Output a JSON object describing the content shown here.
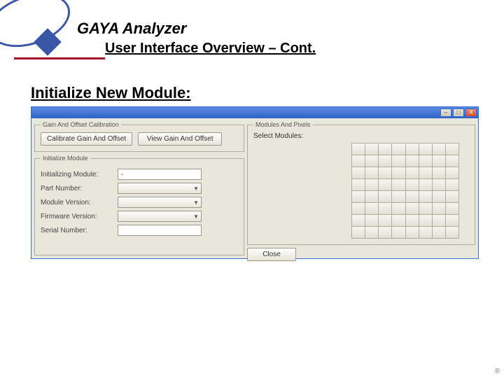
{
  "header": {
    "product": "GAYA Analyzer",
    "subtitle": "User Interface Overview – Cont."
  },
  "section": {
    "title": "Initialize New Module:"
  },
  "window": {
    "title": "",
    "titlebar": {
      "minimize": "–",
      "maximize": "□",
      "close": "X"
    },
    "gainOffset": {
      "legend": "Gain And Offset Calibration",
      "calibrateBtn": "Calibrate Gain And Offset",
      "viewBtn": "View Gain And Offset"
    },
    "initialize": {
      "legend": "Initialize Module",
      "fields": {
        "initializing": {
          "label": "Initializing Module:",
          "value": "-"
        },
        "partNumber": {
          "label": "Part Number:",
          "value": ""
        },
        "moduleVersion": {
          "label": "Module Version:",
          "value": ""
        },
        "firmwareVersion": {
          "label": "Firmware Version:",
          "value": ""
        },
        "serialNumber": {
          "label": "Serial Number:",
          "value": ""
        }
      }
    },
    "modules": {
      "legend": "Modules And Pixels",
      "selectLabel": "Select Modules:",
      "gridRows": 8,
      "gridCols": 8
    },
    "closeBtn": "Close"
  },
  "footer": {
    "mark": "®"
  }
}
